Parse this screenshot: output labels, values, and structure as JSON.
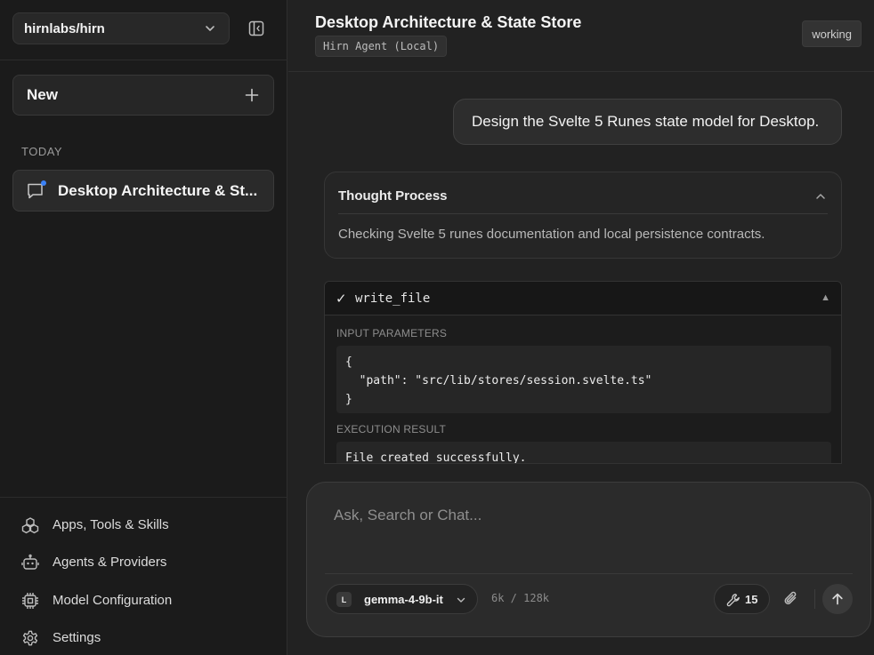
{
  "sidebar": {
    "repo": "hirnlabs/hirn",
    "new_label": "New",
    "section_label": "TODAY",
    "chats": [
      {
        "title": "Desktop Architecture & St..."
      }
    ],
    "nav": [
      {
        "label": "Apps, Tools & Skills",
        "icon": "apps-icon"
      },
      {
        "label": "Agents & Providers",
        "icon": "robot-icon"
      },
      {
        "label": "Model Configuration",
        "icon": "chip-icon"
      },
      {
        "label": "Settings",
        "icon": "gear-icon"
      }
    ]
  },
  "header": {
    "title": "Desktop Architecture & State Store",
    "agent": "Hirn Agent (Local)",
    "status": "working"
  },
  "conversation": {
    "user_message": "Design the Svelte 5 Runes state model for Desktop.",
    "thought": {
      "title": "Thought Process",
      "text": "Checking Svelte 5 runes documentation and local persistence contracts."
    },
    "tool_call": {
      "check": "✓",
      "name": "write_file",
      "toggle": "▲",
      "input_label": "INPUT PARAMETERS",
      "input": "{\n  \"path\": \"src/lib/stores/session.svelte.ts\"\n}",
      "result_label": "EXECUTION RESULT",
      "result": "File created successfully."
    }
  },
  "composer": {
    "placeholder": "Ask, Search or Chat...",
    "model_badge": "L",
    "model": "gemma-4-9b-it",
    "tokens": "6k / 128k",
    "tools_count": "15"
  },
  "colors": {
    "background": "#222222",
    "sidebar": "#1b1b1b",
    "unread_dot": "#3b82f6"
  }
}
